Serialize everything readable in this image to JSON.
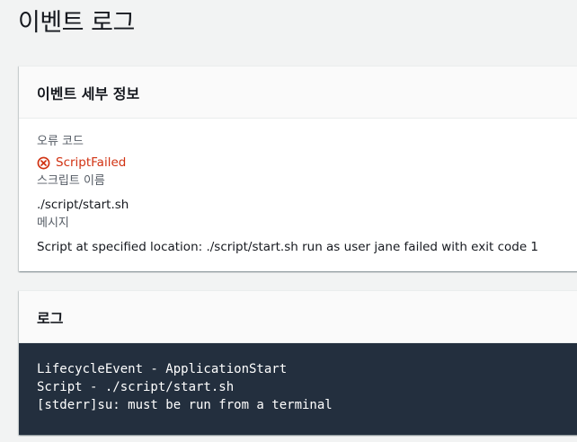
{
  "page": {
    "title": "이벤트 로그"
  },
  "details_panel": {
    "header": "이벤트 세부 정보",
    "error_code_label": "오류 코드",
    "error_code_value": "ScriptFailed",
    "error_icon": "error-circle-x-icon",
    "script_name_label": "스크립트 이름",
    "script_name_value": "./script/start.sh",
    "message_label": "메시지",
    "message_value": "Script at specified location: ./script/start.sh run as user jane failed with exit code 1"
  },
  "logs_panel": {
    "header": "로그",
    "lines": [
      "LifecycleEvent - ApplicationStart",
      "Script - ./script/start.sh",
      "[stderr]su: must be run from a terminal"
    ]
  },
  "colors": {
    "error": "#d13212",
    "terminal_bg": "#232f3e",
    "page_bg": "#f2f3f3"
  }
}
